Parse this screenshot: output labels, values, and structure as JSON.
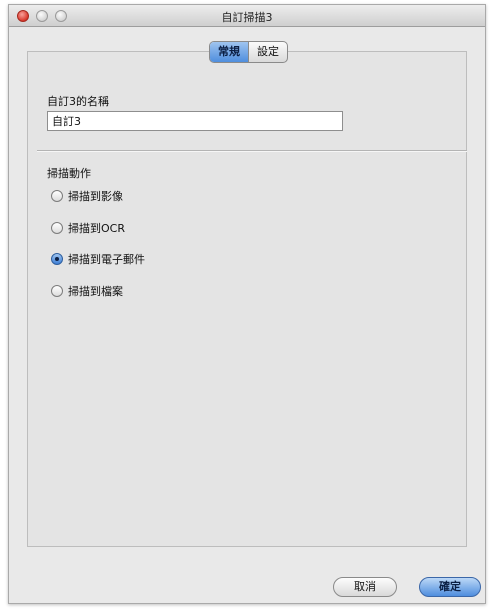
{
  "window": {
    "title": "自訂掃描3"
  },
  "tabs": [
    {
      "label": "常規",
      "active": true
    },
    {
      "label": "設定",
      "active": false
    }
  ],
  "name_section": {
    "label": "自訂3的名稱",
    "value": "自訂3"
  },
  "action_section": {
    "label": "掃描動作",
    "options": [
      {
        "label": "掃描到影像",
        "selected": false
      },
      {
        "label": "掃描到OCR",
        "selected": false
      },
      {
        "label": "掃描到電子郵件",
        "selected": true
      },
      {
        "label": "掃描到檔案",
        "selected": false
      }
    ]
  },
  "buttons": {
    "cancel_label": "取消",
    "ok_label": "確定"
  },
  "colors": {
    "accent": "#4f8ede",
    "close_button": "#d9372b",
    "window_background": "#e9e9e9"
  }
}
